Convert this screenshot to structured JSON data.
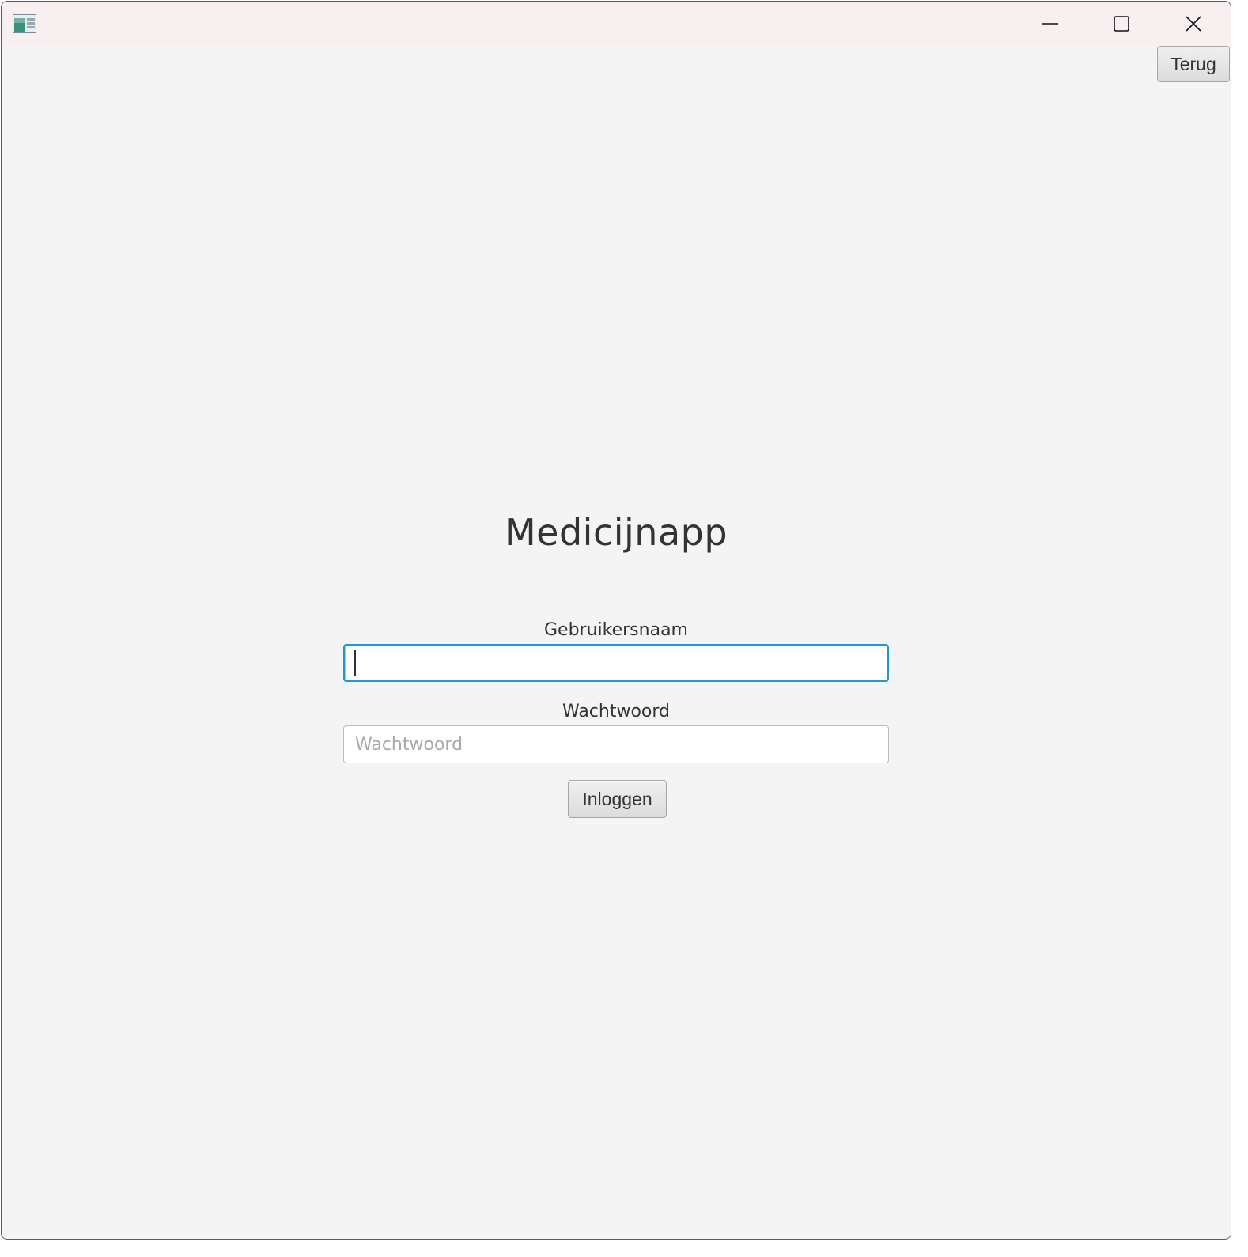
{
  "window": {
    "controls": {
      "minimize": "minimize-icon",
      "maximize": "maximize-icon",
      "close": "close-icon"
    }
  },
  "toolbar": {
    "back_label": "Terug"
  },
  "app": {
    "title": "Medicijnapp"
  },
  "login_form": {
    "username_label": "Gebruikersnaam",
    "username_value": "",
    "password_label": "Wachtwoord",
    "password_placeholder": "Wachtwoord",
    "login_label": "Inloggen"
  },
  "colors": {
    "background": "#f4f4f4",
    "titlebar": "#f8eff0",
    "focus_accent": "#1e9ad6",
    "text": "#333333"
  }
}
